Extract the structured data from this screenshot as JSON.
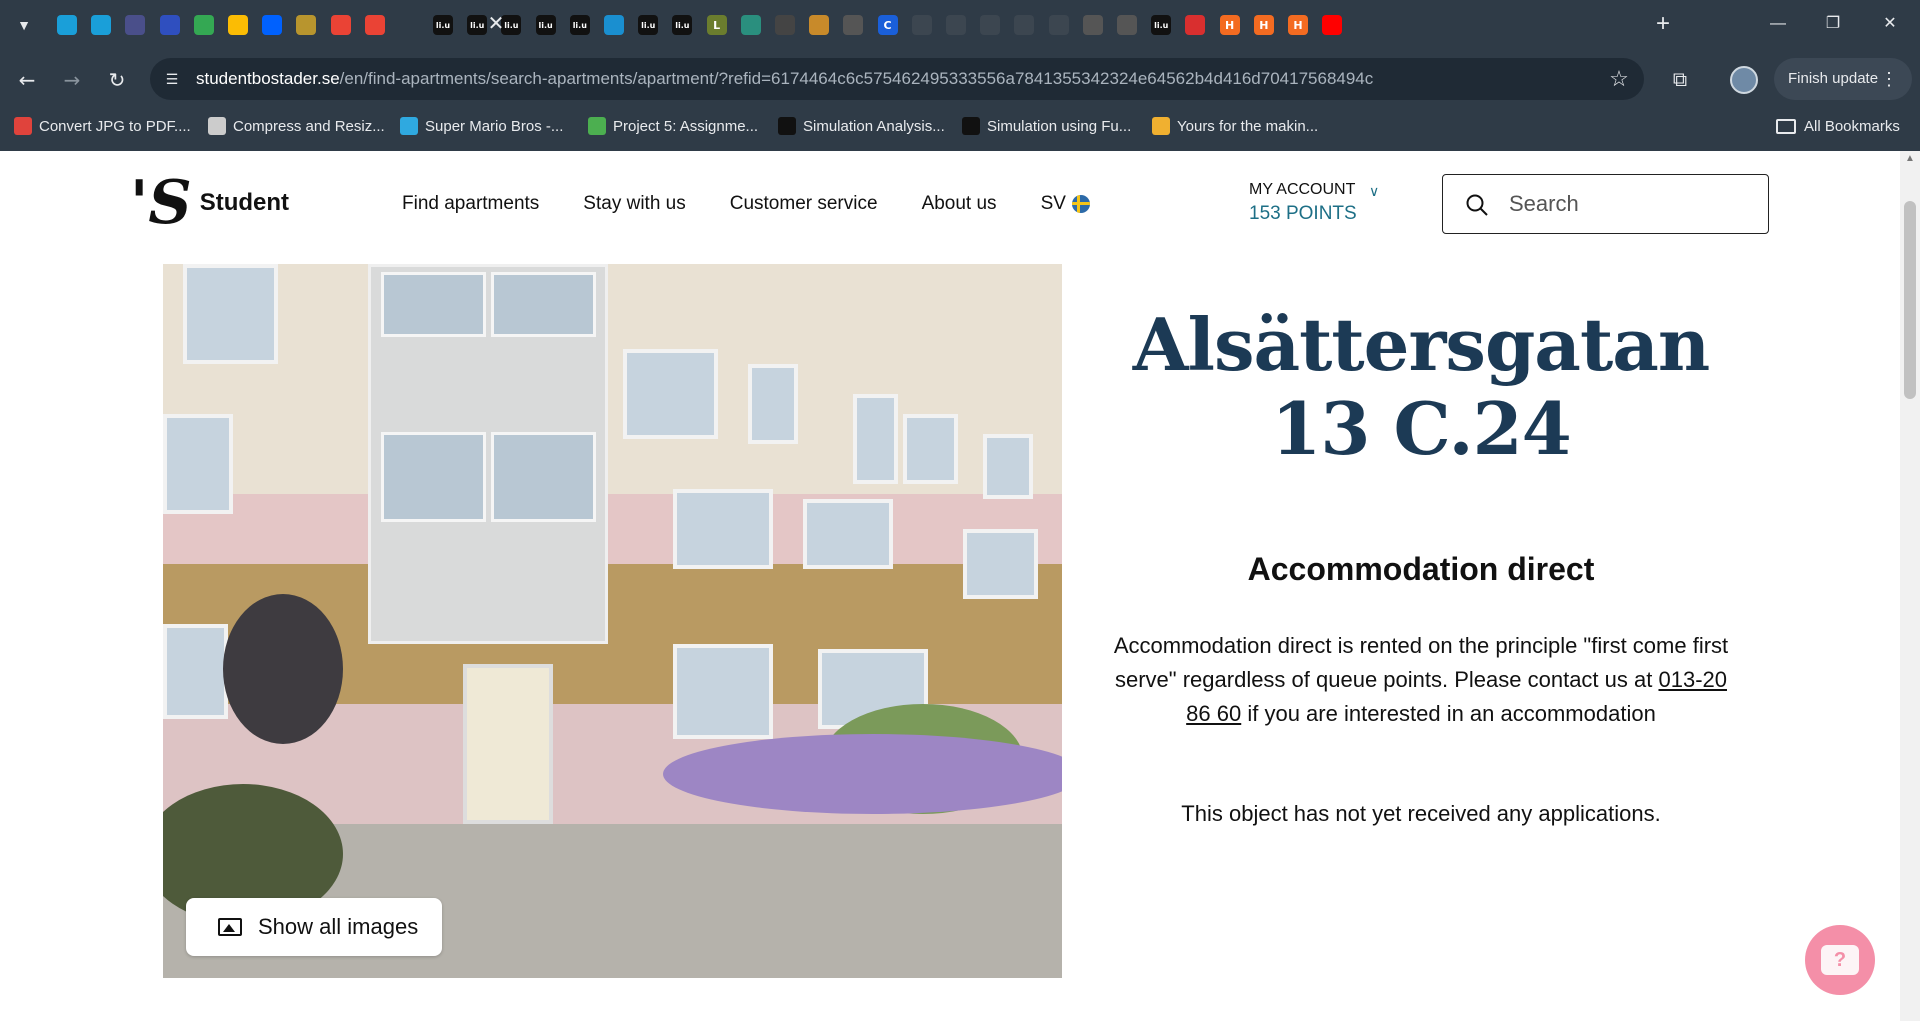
{
  "browser": {
    "tab_count_note": "",
    "tabs": [
      {
        "icon": "link-icon",
        "color": "#1a9fd9"
      },
      {
        "icon": "link-icon",
        "color": "#1a9fd9"
      },
      {
        "icon": "circle-logo-icon",
        "color": "#4a4f8a"
      },
      {
        "icon": "shield-icon",
        "color": "#2f4fbf"
      },
      {
        "icon": "google-drive-icon",
        "color": "#34a853"
      },
      {
        "icon": "google-drive-icon",
        "color": "#fbbc04"
      },
      {
        "icon": "dropbox-icon",
        "color": "#0061fe"
      },
      {
        "icon": "tab-icon",
        "color": "#b8952e"
      },
      {
        "icon": "gmail-icon",
        "color": "#ea4335"
      },
      {
        "icon": "gmail-icon",
        "color": "#ea4335"
      },
      {
        "icon": "liu-icon",
        "color": "#111111",
        "label": "li.u"
      },
      {
        "icon": "liu-icon",
        "color": "#111111",
        "label": "li.u"
      },
      {
        "icon": "liu-icon",
        "color": "#111111",
        "label": "li.u"
      },
      {
        "icon": "liu-icon",
        "color": "#111111",
        "label": "li.u"
      },
      {
        "icon": "liu-icon",
        "color": "#111111",
        "label": "li.u"
      },
      {
        "icon": "send-icon",
        "color": "#1a8fd0"
      },
      {
        "icon": "liu-icon",
        "color": "#111111",
        "label": "li.u"
      },
      {
        "icon": "liu-icon",
        "color": "#111111",
        "label": "li.u"
      },
      {
        "icon": "letter-l-icon",
        "color": "#6b7d2e",
        "label": "L"
      },
      {
        "icon": "book-icon",
        "color": "#2a8f7e"
      },
      {
        "icon": "society-icon",
        "color": "#444444"
      },
      {
        "icon": "wheel-icon",
        "color": "#c88a2a"
      },
      {
        "icon": "helmet-icon",
        "color": "#555555"
      },
      {
        "icon": "letter-c-icon",
        "color": "#1a5fd9",
        "label": "C"
      },
      {
        "icon": "tab-icon",
        "color": "#3c4650"
      },
      {
        "icon": "tab-icon",
        "color": "#3c4650"
      },
      {
        "icon": "tab-icon",
        "color": "#3c4650"
      },
      {
        "icon": "tab-icon",
        "color": "#3c4650"
      },
      {
        "icon": "tab-icon",
        "color": "#3c4650"
      },
      {
        "icon": "gear-icon",
        "color": "#555555"
      },
      {
        "icon": "gear-icon",
        "color": "#555555"
      },
      {
        "icon": "liu-icon",
        "color": "#111111",
        "label": "li.u"
      },
      {
        "icon": "red-circle-icon",
        "color": "#d92f2f"
      },
      {
        "icon": "letter-h-icon",
        "color": "#f36b21",
        "label": "H"
      },
      {
        "icon": "letter-h-icon",
        "color": "#f36b21",
        "label": "H"
      },
      {
        "icon": "letter-h-icon",
        "color": "#f36b21",
        "label": "H"
      },
      {
        "icon": "youtube-icon",
        "color": "#ff0000"
      }
    ],
    "url_host": "studentbostader.se",
    "url_path": "/en/find-apartments/search-apartments/apartment/?refid=6174464c6c575462495333556a7841355342324e64562b4d416d70417568494c",
    "finish_update_label": "Finish update",
    "bookmarks": [
      {
        "label": "Convert JPG to PDF....",
        "icon": "heart-icon",
        "color": "#e0433c"
      },
      {
        "label": "Compress and Resiz...",
        "icon": "globe-icon",
        "color": "#cccccc"
      },
      {
        "label": "Super Mario Bros -...",
        "icon": "mario-icon",
        "color": "#2fa9e0"
      },
      {
        "label": "Project 5: Assignme...",
        "icon": "waveform-icon",
        "color": "#4caf50"
      },
      {
        "label": "Simulation Analysis...",
        "icon": "arrow-logo-icon",
        "color": "#111111"
      },
      {
        "label": "Simulation using Fu...",
        "icon": "arrow-logo-icon",
        "color": "#111111"
      },
      {
        "label": "Yours for the makin...",
        "icon": "emoji-icon",
        "color": "#f0b030"
      }
    ],
    "all_bookmarks_label": "All Bookmarks"
  },
  "site": {
    "logo_mark": "'S",
    "logo_text": "Student",
    "nav": [
      {
        "label": "Find apartments"
      },
      {
        "label": "Stay with us"
      },
      {
        "label": "Customer service"
      },
      {
        "label": "About us"
      }
    ],
    "language_label": "SV",
    "account_label": "MY ACCOUNT",
    "account_points": "153 POINTS",
    "search_placeholder": "Search",
    "accent_color": "#1d6f86",
    "title_color": "#1c3a55"
  },
  "listing": {
    "title": "Alsättersgatan 13 C.24",
    "show_images_label": "Show all images",
    "subtitle": "Accommodation direct",
    "description_before": "Accommodation direct is rented on the principle \"first come first serve\" regardless of queue points. Please contact us at",
    "phone": "013-20 86 60",
    "description_after": "if you are interested in an accommodation",
    "status_text": "This object has not yet received any applications."
  },
  "chat": {
    "icon": "chat-bubble-icon",
    "color": "#f48fa8",
    "glyph": "?"
  }
}
